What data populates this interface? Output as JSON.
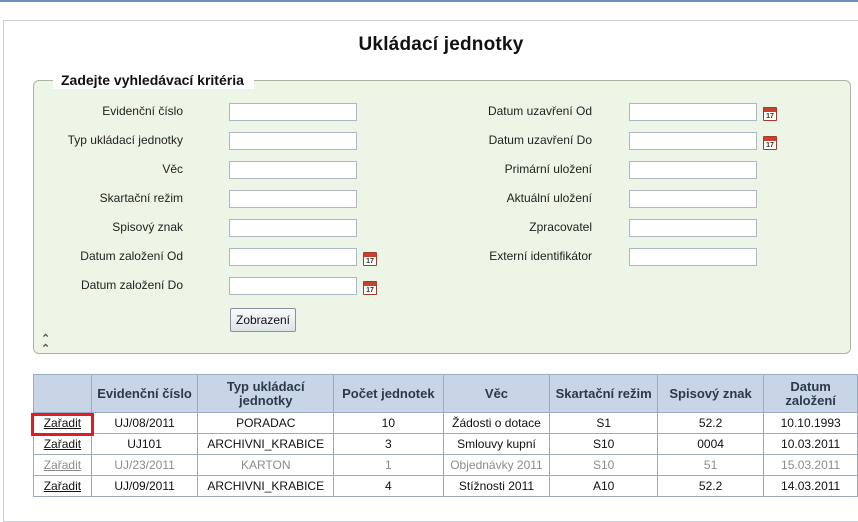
{
  "page": {
    "title": "Ukládací jednotky"
  },
  "search": {
    "legend": "Zadejte vyhledávací kritéria",
    "left_fields": [
      {
        "label": "Evidenční číslo",
        "value": ""
      },
      {
        "label": "Typ ukládací jednotky",
        "value": ""
      },
      {
        "label": "Věc",
        "value": ""
      },
      {
        "label": "Skartační režim",
        "value": ""
      },
      {
        "label": "Spisový znak",
        "value": ""
      },
      {
        "label": "Datum založení Od",
        "value": ""
      },
      {
        "label": "Datum založení Do",
        "value": ""
      }
    ],
    "right_fields": [
      {
        "label": "Datum uzavření Od",
        "value": ""
      },
      {
        "label": "Datum uzavření Do",
        "value": ""
      },
      {
        "label": "Primární uložení",
        "value": ""
      },
      {
        "label": "Aktuální uložení",
        "value": ""
      },
      {
        "label": "Zpracovatel",
        "value": ""
      },
      {
        "label": "Externí identifikátor",
        "value": ""
      }
    ],
    "calendar_icon_text": "17",
    "submit_label": "Zobrazení",
    "collapse_icon": "double-chevron-up-icon"
  },
  "table": {
    "headers": [
      "",
      "Evidenční číslo",
      "Typ ukládací jednotky",
      "Počet jednotek",
      "Věc",
      "Skartační režim",
      "Spisový znak",
      "Datum založení"
    ],
    "rows": [
      {
        "action": "Zařadit",
        "evidencni_cislo": "UJ/08/2011",
        "typ": "PORADAC",
        "pocet": "10",
        "vec": "Žádosti o dotace",
        "rezim": "S1",
        "znak": "52.2",
        "datum": "10.10.1993",
        "dimmed": false
      },
      {
        "action": "Zařadit",
        "evidencni_cislo": "UJ101",
        "typ": "ARCHIVNI_KRABICE",
        "pocet": "3",
        "vec": "Smlouvy kupní",
        "rezim": "S10",
        "znak": "0004",
        "datum": "10.03.2011",
        "dimmed": false
      },
      {
        "action": "Zařadit",
        "evidencni_cislo": "UJ/23/2011",
        "typ": "KARTON",
        "pocet": "1",
        "vec": "Objednávky 2011",
        "rezim": "S10",
        "znak": "51",
        "datum": "15.03.2011",
        "dimmed": true
      },
      {
        "action": "Zařadit",
        "evidencni_cislo": "UJ/09/2011",
        "typ": "ARCHIVNI_KRABICE",
        "pocet": "4",
        "vec": "Stížnosti 2011",
        "rezim": "A10",
        "znak": "52.2",
        "datum": "14.03.2011",
        "dimmed": false
      }
    ]
  },
  "colors": {
    "header_bg": "#c7d5e7",
    "panel_bg": "#edf5e6",
    "highlight": "#e01b24"
  }
}
